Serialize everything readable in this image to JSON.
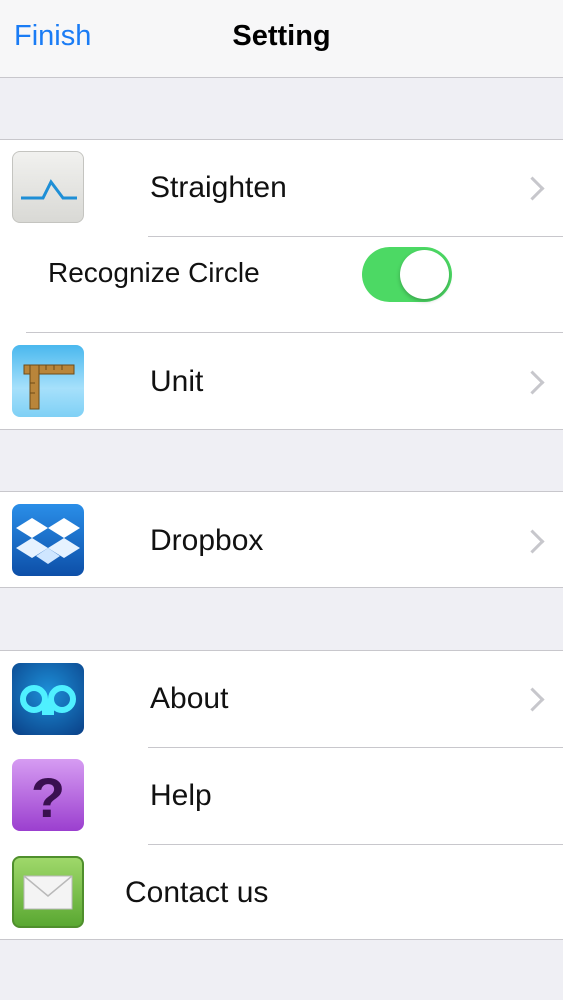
{
  "navbar": {
    "left_button": "Finish",
    "title": "Setting"
  },
  "colors": {
    "accent": "#1a7cf5",
    "toggle_on": "#4cd964",
    "background": "#efeff4"
  },
  "groups": [
    {
      "rows": [
        {
          "label": "Straighten",
          "icon": "straighten-line-icon",
          "chevron": true
        },
        {
          "label": "Recognize Circle",
          "toggle": true,
          "toggle_on": true
        },
        {
          "label": "Unit",
          "icon": "ruler-icon",
          "chevron": true
        }
      ]
    },
    {
      "rows": [
        {
          "label": "Dropbox",
          "icon": "dropbox-icon",
          "chevron": true
        }
      ]
    },
    {
      "rows": [
        {
          "label": "About",
          "icon": "app-logo-icon",
          "chevron": true
        },
        {
          "label": "Help",
          "icon": "question-mark-icon",
          "chevron": false
        },
        {
          "label": "Contact us",
          "icon": "mail-envelope-icon",
          "chevron": false
        }
      ]
    }
  ]
}
